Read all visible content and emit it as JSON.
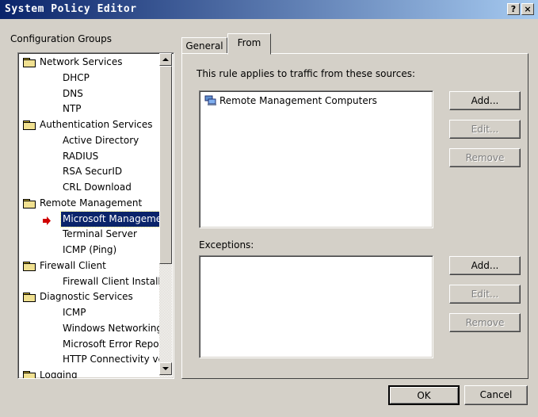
{
  "window": {
    "title": "System Policy Editor",
    "help_button": "?",
    "close_button": "×"
  },
  "sidebar": {
    "header": "Configuration Groups",
    "items": [
      {
        "label": "Network Services",
        "type": "folder"
      },
      {
        "label": "DHCP",
        "type": "child"
      },
      {
        "label": "DNS",
        "type": "child"
      },
      {
        "label": "NTP",
        "type": "child"
      },
      {
        "label": "Authentication Services",
        "type": "folder"
      },
      {
        "label": "Active Directory",
        "type": "child"
      },
      {
        "label": "RADIUS",
        "type": "child"
      },
      {
        "label": "RSA SecurID",
        "type": "child"
      },
      {
        "label": "CRL Download",
        "type": "child"
      },
      {
        "label": "Remote Management",
        "type": "folder"
      },
      {
        "label": "Microsoft Manageme",
        "type": "child",
        "selected": true
      },
      {
        "label": "Terminal Server",
        "type": "child"
      },
      {
        "label": "ICMP (Ping)",
        "type": "child"
      },
      {
        "label": "Firewall Client",
        "type": "folder"
      },
      {
        "label": "Firewall Client Install",
        "type": "child"
      },
      {
        "label": "Diagnostic Services",
        "type": "folder"
      },
      {
        "label": "ICMP",
        "type": "child"
      },
      {
        "label": "Windows Networking",
        "type": "child"
      },
      {
        "label": "Microsoft Error Repo",
        "type": "child"
      },
      {
        "label": "HTTP Connectivity ve",
        "type": "child"
      },
      {
        "label": "Logging",
        "type": "folder"
      }
    ]
  },
  "tabs": [
    {
      "label": "General",
      "active": false
    },
    {
      "label": "From",
      "active": true
    }
  ],
  "from_tab": {
    "sources_label": "This rule applies to traffic from these sources:",
    "sources": [
      "Remote Management Computers"
    ],
    "add_button": "Add...",
    "edit_button": "Edit...",
    "remove_button": "Remove",
    "exceptions_label": "Exceptions:",
    "exceptions": [],
    "exc_add_button": "Add...",
    "exc_edit_button": "Edit...",
    "exc_remove_button": "Remove"
  },
  "footer": {
    "ok_button": "OK",
    "cancel_button": "Cancel"
  },
  "colors": {
    "titlebar_start": "#0a246a",
    "titlebar_end": "#a6caf0",
    "selection": "#0a246a",
    "arrow": "#d00000"
  }
}
